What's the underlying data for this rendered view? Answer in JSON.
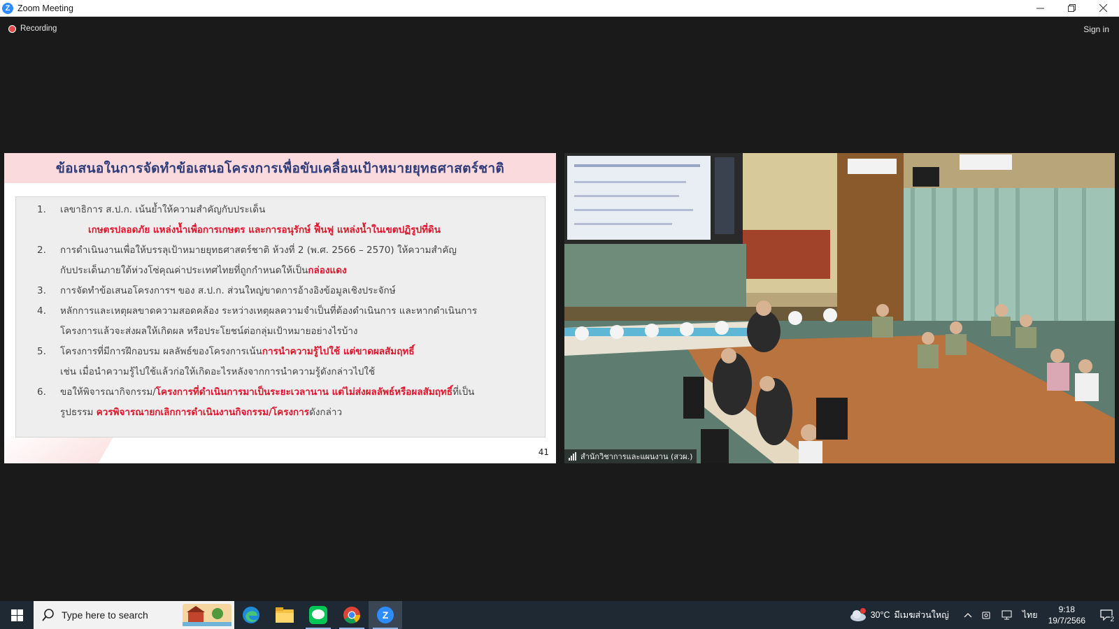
{
  "window": {
    "title": "Zoom Meeting",
    "controls": [
      "minimize",
      "restore",
      "close"
    ]
  },
  "meeting": {
    "recording_label": "Recording",
    "sign_in_label": "Sign in"
  },
  "slide": {
    "title": "ข้อเสนอในการจัดทำข้อเสนอโครงการเพื่อขับเคลื่อนเป้าหมายยุทธศาสตร์ชาติ",
    "page_number": "41",
    "items": [
      {
        "num": "1.",
        "text": "เลขาธิการ ส.ป.ก. เน้นย้ำให้ความสำคัญกับประเด็น",
        "emphasis": "เกษตรปลอดภัย แหล่งน้ำเพื่อการเกษตร และการอนุรักษ์ ฟื้นฟู แหล่งน้ำในเขตปฏิรูปที่ดิน"
      },
      {
        "num": "2.",
        "text": "การดำเนินงานเพื่อให้บรรลุเป้าหมายยุทธศาสตร์ชาติ ห้วงที่ 2 (พ.ศ. 2566 – 2570) ให้ความสำคัญ",
        "text2": "กับประเด็นภายใต้ห่วงโซ่คุณค่าประเทศไทยที่ถูกกำหนดให้เป็น",
        "red": "กล่องแดง"
      },
      {
        "num": "3.",
        "text": "การจัดทำข้อเสนอโครงการฯ ของ ส.ป.ก. ส่วนใหญ่ขาดการอ้างอิงข้อมูลเชิงประจักษ์"
      },
      {
        "num": "4.",
        "text": "หลักการและเหตุผลขาดความสอดคล้อง ระหว่างเหตุผลความจำเป็นที่ต้องดำเนินการ และหากดำเนินการ",
        "text2": "โครงการแล้วจะส่งผลให้เกิดผล หรือประโยชน์ต่อกลุ่มเป้าหมายอย่างไรบ้าง"
      },
      {
        "num": "5.",
        "text": "โครงการที่มีการฝึกอบรม ผลลัพธ์ของโครงการเน้น",
        "red": "การนำความรู้ไปใช้ แต่ขาดผลสัมฤทธิ์",
        "text2": "เช่น เมื่อนำความรู้ไปใช้แล้วก่อให้เกิดอะไรหลังจากการนำความรู้ดังกล่าวไปใช้"
      },
      {
        "num": "6.",
        "text": "ขอให้พิจารณากิจกรรม/",
        "red": "โครงการที่ดำเนินการมาเป็นระยะเวลานาน แต่ไม่ส่งผลลัพธ์หรือผลสัมฤทธิ์",
        "text_after": "ที่เป็น",
        "text2": "รูปธรรม ",
        "red2": "ควรพิจารณายกเลิกการดำเนินงานกิจกรรม/โครงการ",
        "text2_after": "ดังกล่าว"
      }
    ]
  },
  "video": {
    "participant_name": "สำนักวิชาการและแผนงาน (สวผ.)"
  },
  "taskbar": {
    "search_placeholder": "Type here to search",
    "apps": [
      "edge-icon",
      "file-explorer-icon",
      "line-icon",
      "chrome-icon",
      "zoom-icon"
    ],
    "weather_temp": "30°C",
    "weather_text": "มีเมฆส่วนใหญ่",
    "language": "ไทย",
    "time": "9:18",
    "date": "19/7/2566",
    "notification_count": "2",
    "colors": {
      "taskbar": "#1f2933",
      "accent_red": "#e0142c",
      "title_blue": "#2f3c7a"
    }
  }
}
